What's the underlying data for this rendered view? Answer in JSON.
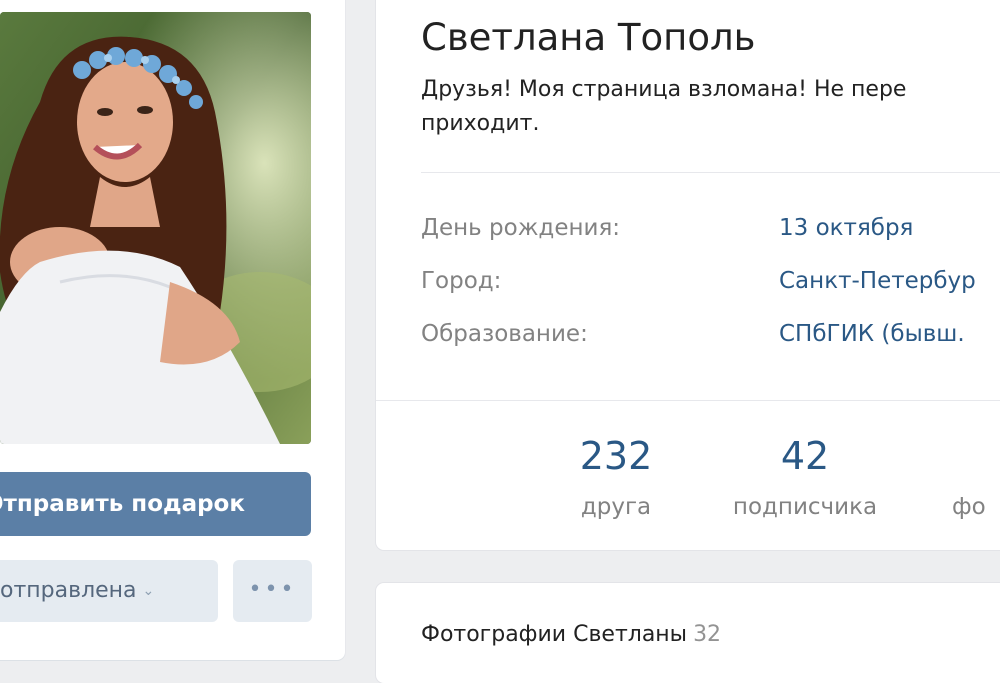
{
  "profile": {
    "name": "Светлана Тополь",
    "status_line1": "Друзья! Моя страница взломана! Не пере",
    "status_line2": "приходит."
  },
  "info": [
    {
      "label": "День рождения:",
      "value": "13 октября"
    },
    {
      "label": "Город:",
      "value": "Санкт-Петербур"
    },
    {
      "label": "Образование:",
      "value": "СПбГИК (бывш."
    }
  ],
  "counters": [
    {
      "num": "232",
      "caption": "друга"
    },
    {
      "num": "42",
      "caption": "подписчика"
    },
    {
      "num": "",
      "caption": "фо"
    }
  ],
  "actions": {
    "gift_label": "Отправить подарок",
    "request_label": "отправлена",
    "more_label": "•••"
  },
  "photos": {
    "title": "Фотографии Светланы",
    "count": "32"
  },
  "colors": {
    "accent": "#5b7fa6",
    "link": "#2a5885",
    "muted": "#828282",
    "background": "#edeef0"
  }
}
